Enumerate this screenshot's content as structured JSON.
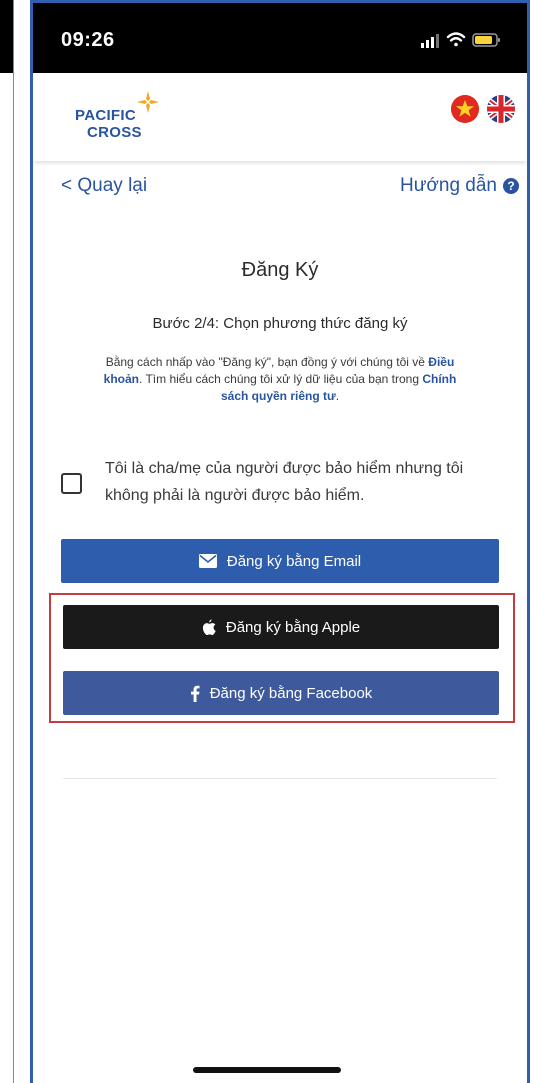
{
  "status_bar": {
    "time": "09:26",
    "icons": [
      "signal-icon",
      "wifi-icon",
      "battery-icon"
    ],
    "battery_color": "#f5d33a"
  },
  "header": {
    "logo_line1": "PACIFIC",
    "logo_line2": "CROSS",
    "languages": [
      "vietnamese-flag-icon",
      "uk-flag-icon"
    ],
    "brand_color": "#2a54a0"
  },
  "nav": {
    "back_label": "< Quay lại",
    "help_label": "Hướng dẫn",
    "help_icon": "?"
  },
  "main": {
    "title": "Đăng Ký",
    "step": "Bước 2/4: Chọn phương thức đăng ký",
    "terms": {
      "part1": "Bằng cách nhấp vào \"Đăng ký\", bạn đồng ý với chúng tôi về",
      "link1": "Điều khoản",
      "part2": ". Tìm hiểu cách chúng tôi xử lý dữ liệu của bạn trong",
      "link2": "Chính sách quyền riêng tư",
      "part3": "."
    },
    "checkbox_label": "Tôi là cha/mẹ của người được bảo hiểm nhưng tôi không phải là người được bảo hiểm.",
    "checkbox_checked": false,
    "buttons": {
      "email": "Đăng ký bằng Email",
      "apple": "Đăng ký bằng Apple",
      "facebook": "Đăng ký bằng Facebook"
    },
    "colors": {
      "email_button": "#2f5dae",
      "apple_button": "#1a1a1a",
      "facebook_button": "#3e5a9c",
      "highlight_border": "#c73a3e"
    }
  }
}
